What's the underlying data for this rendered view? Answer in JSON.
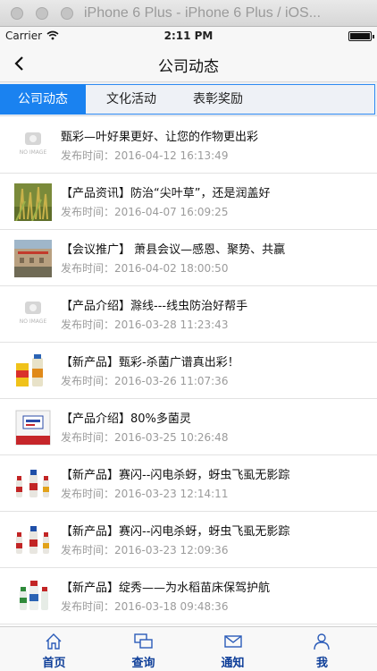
{
  "window": {
    "title": "iPhone 6 Plus - iPhone 6 Plus / iOS..."
  },
  "status_bar": {
    "carrier": "Carrier",
    "time": "2:11 PM"
  },
  "nav": {
    "title": "公司动态"
  },
  "tabs": [
    {
      "label": "公司动态",
      "active": true
    },
    {
      "label": "文化活动",
      "active": false
    },
    {
      "label": "表彰奖励",
      "active": false
    }
  ],
  "colors": {
    "accent": "#1a82f0",
    "tab_label": "#0f3f99",
    "time_text": "#9b9b9b"
  },
  "news": [
    {
      "thumb": "no-image",
      "thumb_text": "NO IMAGE",
      "title": "甄彩—叶好果更好、让您的作物更出彩",
      "time": "发布时间：2016-04-12 16:13:49"
    },
    {
      "thumb": "grass-photo",
      "title": "【产品资讯】防治“尖叶草”，还是润盖好",
      "time": "发布时间：2016-04-07 16:09:25"
    },
    {
      "thumb": "meeting-photo",
      "title": "【会议推广】 萧县会议—感恩、聚势、共赢",
      "time": "发布时间：2016-04-02 18:00:50"
    },
    {
      "thumb": "no-image",
      "thumb_text": "NO IMAGE",
      "title": "【产品介绍】滁线---线虫防治好帮手",
      "time": "发布时间：2016-03-28 11:23:43"
    },
    {
      "thumb": "product-bottles",
      "title": "【新产品】甄彩-杀菌广谱真出彩！",
      "time": "发布时间：2016-03-26 11:07:36"
    },
    {
      "thumb": "product-box",
      "title": "【产品介绍】80%多菌灵",
      "time": "发布时间：2016-03-25 10:26:48"
    },
    {
      "thumb": "bottles",
      "title": "【新产品】赛闪--闪电杀蚜，蚜虫飞虱无影踪",
      "time": "发布时间：2016-03-23 12:14:11"
    },
    {
      "thumb": "bottles",
      "title": "【新产品】赛闪--闪电杀蚜，蚜虫飞虱无影踪",
      "time": "发布时间：2016-03-23 12:09:36"
    },
    {
      "thumb": "bottles-2",
      "title": "【新产品】绽秀——为水稻苗床保驾护航",
      "time": "发布时间：2016-03-18 09:48:36"
    }
  ],
  "bottom_tabs": [
    {
      "label": "首页",
      "icon": "home-icon"
    },
    {
      "label": "查询",
      "icon": "query-icon"
    },
    {
      "label": "通知",
      "icon": "mail-icon"
    },
    {
      "label": "我",
      "icon": "person-icon"
    }
  ]
}
